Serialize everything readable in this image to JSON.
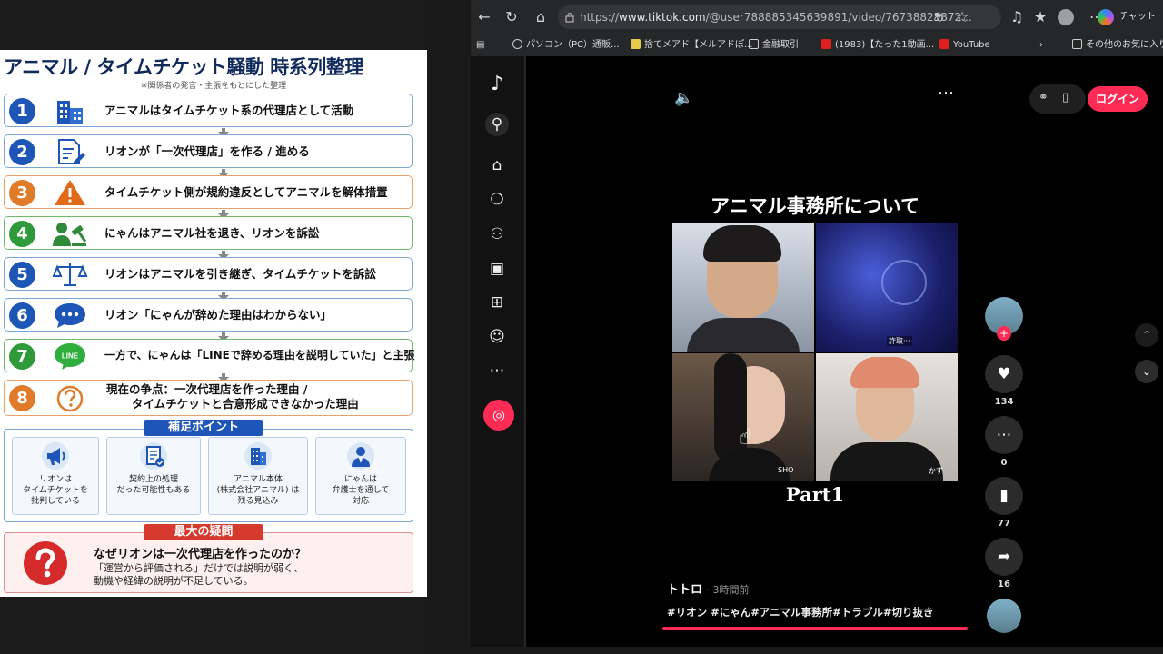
{
  "infographic": {
    "title": "アニマル / タイムチケット騒動 時系列整理",
    "subtitle": "※関係者の発言・主張をもとにした整理",
    "steps": [
      {
        "num": "1",
        "text": "アニマルはタイムチケット系の代理店として活動",
        "icon": "building-icon"
      },
      {
        "num": "2",
        "text": "リオンが「一次代理店」を作る / 進める",
        "icon": "document-edit-icon"
      },
      {
        "num": "3",
        "text": "タイムチケット側が規約違反としてアニマルを解体措置",
        "icon": "warning-icon"
      },
      {
        "num": "4",
        "text": "にゃんはアニマル社を退き、リオンを訴訟",
        "icon": "gavel-person-icon"
      },
      {
        "num": "5",
        "text": "リオンはアニマルを引き継ぎ、タイムチケットを訴訟",
        "icon": "scales-icon"
      },
      {
        "num": "6",
        "text": "リオン「にゃんが辞めた理由はわからない」",
        "icon": "chat-bubble-icon"
      },
      {
        "num": "7",
        "text": "一方で、にゃんは「LINEで辞める理由を説明していた」と主張",
        "icon": "line-icon"
      },
      {
        "num": "8",
        "text_line1": "現在の争点：一次代理店を作った理由 /",
        "text_line2": "タイムチケットと合意形成できなかった理由",
        "icon": "question-circle-icon"
      }
    ],
    "line_icon_text": "LINE",
    "supplement_label": "補足ポイント",
    "supplements": [
      {
        "line1": "リオンは",
        "line2": "タイムチケットを",
        "line3": "批判している",
        "icon": "megaphone-icon"
      },
      {
        "line1": "契約上の処理",
        "line2": "だった可能性もある",
        "line3": "",
        "icon": "contract-icon"
      },
      {
        "line1": "アニマル本体",
        "line2": "(株式会社アニマル) は",
        "line3": "残る見込み",
        "icon": "building-icon"
      },
      {
        "line1": "にゃんは",
        "line2": "弁護士を通して",
        "line3": "対応",
        "icon": "lawyer-icon"
      }
    ],
    "question_label": "最大の疑問",
    "question_title": "なぜリオンは一次代理店を作ったのか？",
    "question_body1": "「運営から評価される」だけでは説明が弱く、",
    "question_body2": "動機や経緯の説明が不足している。",
    "colors": {
      "blue": "#1e56b8",
      "orange": "#e07b2a",
      "green": "#2f9a3a",
      "red": "#d63a2f",
      "navy": "#102a5c"
    }
  },
  "browser": {
    "url_prefix": "https://",
    "url_host": "www.tiktok.com",
    "url_path": "/@user788885345639891/video/76738825872...",
    "copilot_label": "チャット",
    "bookmarks": [
      "パソコン（PC）通販...",
      "捨てメアド【メルアドぽ...",
      "金融取引",
      "(1983)【たった1動画...",
      "YouTube",
      "その他のお気に入り"
    ]
  },
  "tiktok": {
    "login_label": "ログイン",
    "video_title": "アニマル事務所について",
    "part_label": "Part1",
    "tile_labels": {
      "tile2": "詐取···",
      "tile3": "SHO",
      "tile4": "かず"
    },
    "author": "トトロ",
    "time_ago": "· 3時間前",
    "hashtags": "#リオン #にゃん#アニマル事務所#トラブル#切り抜き",
    "likes": "134",
    "comments": "0",
    "saves": "77",
    "shares": "16"
  }
}
